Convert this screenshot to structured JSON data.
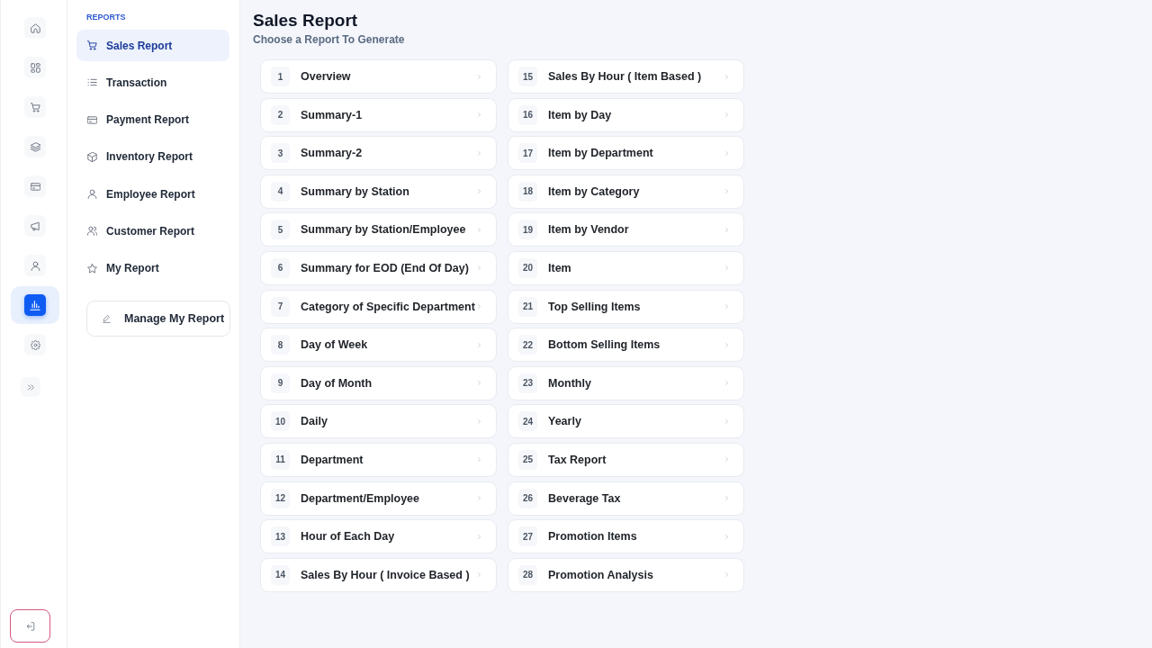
{
  "rail": {
    "items": [
      {
        "selected": false
      },
      {
        "selected": false
      },
      {
        "selected": false
      },
      {
        "selected": false
      },
      {
        "selected": false
      },
      {
        "selected": false
      },
      {
        "selected": false
      },
      {
        "selected": true
      },
      {
        "selected": false
      }
    ]
  },
  "sidebar": {
    "section_label": "REPORTS",
    "items": [
      {
        "label": "Sales Report",
        "selected": true
      },
      {
        "label": "Transaction",
        "selected": false
      },
      {
        "label": "Payment Report",
        "selected": false
      },
      {
        "label": "Inventory Report",
        "selected": false
      },
      {
        "label": "Employee Report",
        "selected": false
      },
      {
        "label": "Customer Report",
        "selected": false
      },
      {
        "label": "My Report",
        "selected": false
      }
    ],
    "manage_button": "Manage My Report"
  },
  "header": {
    "title": "Sales Report",
    "subtitle": "Choose a Report To Generate"
  },
  "reports": [
    {
      "number": "1",
      "label": "Overview"
    },
    {
      "number": "2",
      "label": "Summary-1"
    },
    {
      "number": "3",
      "label": "Summary-2"
    },
    {
      "number": "4",
      "label": "Summary by Station"
    },
    {
      "number": "5",
      "label": "Summary by Station/Employee"
    },
    {
      "number": "6",
      "label": "Summary for EOD (End Of Day)"
    },
    {
      "number": "7",
      "label": "Category of Specific Department"
    },
    {
      "number": "8",
      "label": "Day of Week"
    },
    {
      "number": "9",
      "label": "Day of Month"
    },
    {
      "number": "10",
      "label": "Daily"
    },
    {
      "number": "11",
      "label": "Department"
    },
    {
      "number": "12",
      "label": "Department/Employee"
    },
    {
      "number": "13",
      "label": "Hour of Each Day"
    },
    {
      "number": "14",
      "label": "Sales By Hour ( Invoice Based )"
    },
    {
      "number": "15",
      "label": "Sales By Hour ( Item Based )"
    },
    {
      "number": "16",
      "label": "Item by Day"
    },
    {
      "number": "17",
      "label": "Item by Department"
    },
    {
      "number": "18",
      "label": "Item by Category"
    },
    {
      "number": "19",
      "label": "Item by Vendor"
    },
    {
      "number": "20",
      "label": "Item"
    },
    {
      "number": "21",
      "label": "Top Selling Items"
    },
    {
      "number": "22",
      "label": "Bottom Selling Items"
    },
    {
      "number": "23",
      "label": "Monthly"
    },
    {
      "number": "24",
      "label": "Yearly"
    },
    {
      "number": "25",
      "label": "Tax Report"
    },
    {
      "number": "26",
      "label": "Beverage Tax"
    },
    {
      "number": "27",
      "label": "Promotion Items"
    },
    {
      "number": "28",
      "label": "Promotion Analysis"
    }
  ]
}
